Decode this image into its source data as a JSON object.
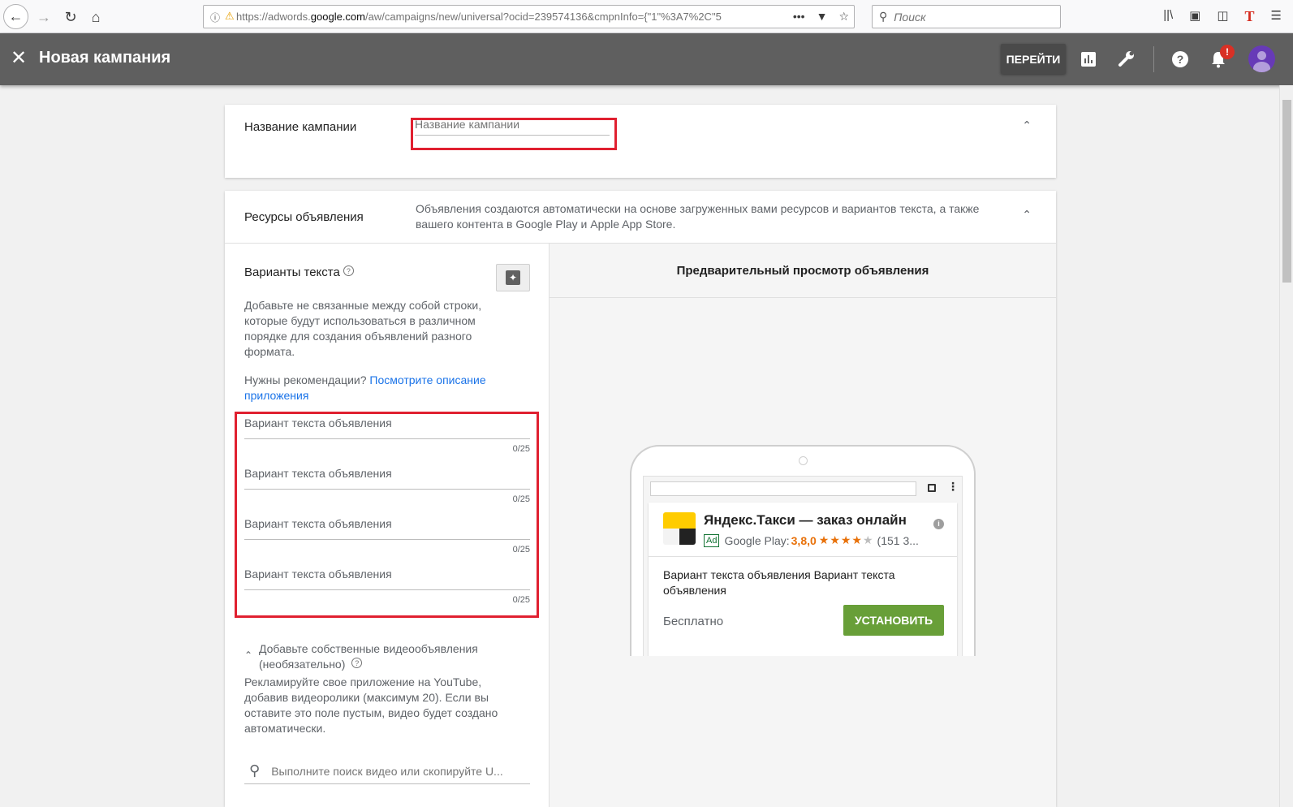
{
  "browser": {
    "url_prefix": "https://adwords.",
    "url_domain": "google.com",
    "url_rest": "/aw/campaigns/new/universal?ocid=239574136&cmpnInfo={\"1\"%3A7%2C\"5",
    "search_placeholder": "Поиск",
    "page_actions_icon": "more-dots-icon"
  },
  "header": {
    "title": "Новая кампания",
    "go_button": "ПЕРЕЙТИ",
    "notification_badge": "!"
  },
  "campaign_name": {
    "label": "Название кампании",
    "input_placeholder": "Название кампании"
  },
  "ad_resources": {
    "label": "Ресурсы объявления",
    "description": "Объявления создаются автоматически на основе загруженных вами ресурсов и вариантов текста, а также вашего контента в Google Play и Apple App Store."
  },
  "text_variants": {
    "title": "Варианты текста",
    "help": "?",
    "intro": "Добавьте не связанные между собой строки, которые будут использоваться в различном порядке для создания объявлений разного формата.",
    "recommend_prefix": "Нужны рекомендации? ",
    "recommend_link": "Посмотрите описание приложения",
    "fields": [
      {
        "placeholder": "Вариант текста объявления",
        "count": "0/25"
      },
      {
        "placeholder": "Вариант текста объявления",
        "count": "0/25"
      },
      {
        "placeholder": "Вариант текста объявления",
        "count": "0/25"
      },
      {
        "placeholder": "Вариант текста объявления",
        "count": "0/25"
      }
    ]
  },
  "video": {
    "toggle_label": "Добавьте собственные видеообъявления (необязательно)",
    "help": "?",
    "description": "Рекламируйте свое приложение на YouTube, добавив видеоролики (максимум 20). Если вы оставите это поле пустым, видео будет создано автоматически.",
    "search_placeholder": "Выполните поиск видео или скопируйте U..."
  },
  "preview": {
    "title": "Предварительный просмотр объявления",
    "ad_title": "Яндекс.Такси — заказ онлайн",
    "ad_badge": "Ad",
    "store": "Google Play:",
    "rating": "3,8,0",
    "rating_value": 3.8,
    "stars_filled": "★★★★",
    "stars_empty": "★",
    "reviews": "(151 3...",
    "info": "i",
    "body": "Вариант текста объявления Вариант текста объявления",
    "price": "Бесплатно",
    "install": "УСТАНОВИТЬ"
  },
  "colors": {
    "header_bg": "#5f5f5f",
    "highlight_red": "#e02030",
    "install_green": "#689f38",
    "link_blue": "#1a73e8",
    "avatar_purple": "#673ab7"
  }
}
